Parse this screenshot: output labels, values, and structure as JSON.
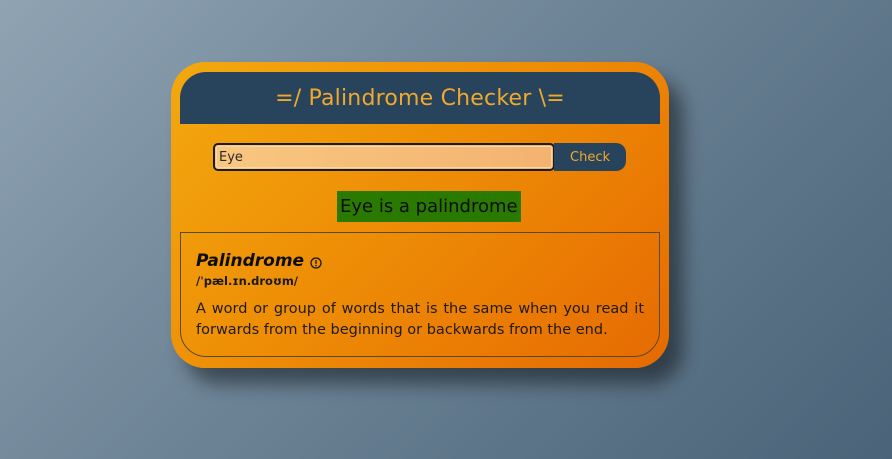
{
  "app": {
    "title": "=/ Palindrome Checker \\="
  },
  "form": {
    "input_value": "Eye",
    "check_label": "Check"
  },
  "result": {
    "text": "Eye is a palindrome",
    "background_color": "#2a7a02"
  },
  "definition": {
    "term": "Palindrome",
    "info_icon": "info-circle-icon",
    "phonetic": "/ˈpæl.ɪn.droʊm/",
    "meaning": "A word or group of words that is the same when you read it forwards from the beginning or backwards from the end."
  },
  "colors": {
    "header_bg": "#27445c",
    "accent_text": "#f2a82c",
    "card_gradient_start": "#f3a90f",
    "card_gradient_end": "#e66a02"
  }
}
